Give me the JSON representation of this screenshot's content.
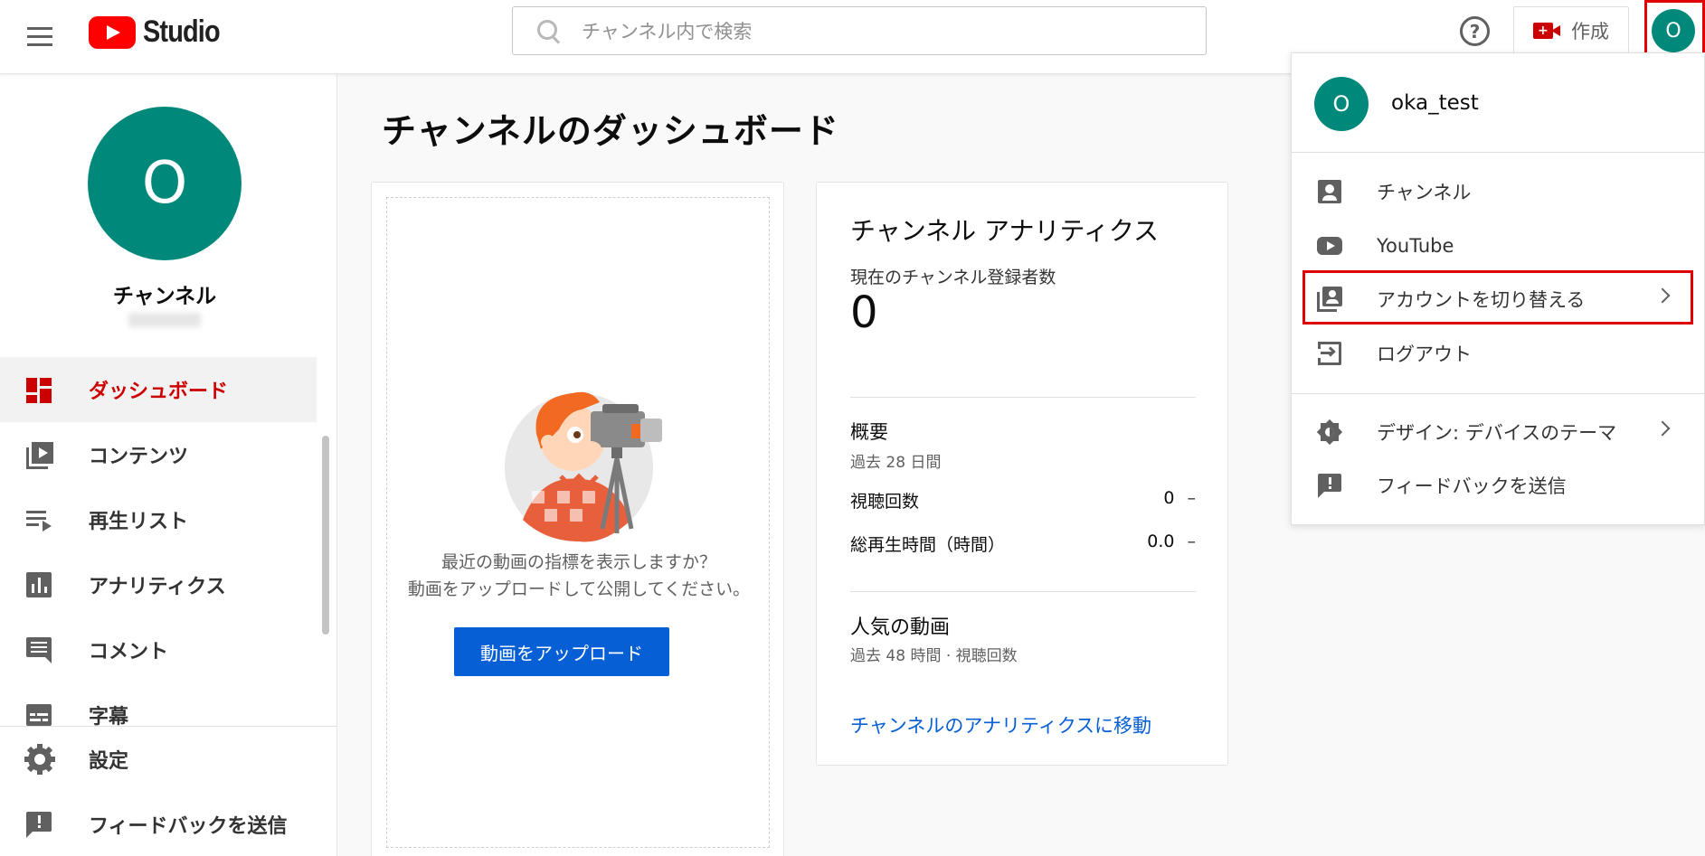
{
  "header": {
    "logo_text": "Studio",
    "search_placeholder": "チャンネル内で検索",
    "help_symbol": "?",
    "create_label": "作成",
    "avatar_letter": "O"
  },
  "sidebar": {
    "avatar_letter": "O",
    "channel_title": "チャンネル",
    "nav": [
      {
        "label": "ダッシュボード",
        "icon": "dashboard-icon",
        "active": true
      },
      {
        "label": "コンテンツ",
        "icon": "content-icon"
      },
      {
        "label": "再生リスト",
        "icon": "playlist-icon"
      },
      {
        "label": "アナリティクス",
        "icon": "analytics-icon"
      },
      {
        "label": "コメント",
        "icon": "comment-icon"
      },
      {
        "label": "字幕",
        "icon": "subtitles-icon"
      }
    ],
    "bottom": [
      {
        "label": "設定",
        "icon": "gear-icon"
      },
      {
        "label": "フィードバックを送信",
        "icon": "feedback-icon"
      }
    ]
  },
  "main": {
    "page_title": "チャンネルのダッシュボード",
    "upload_card": {
      "text_line1": "最近の動画の指標を表示しますか？",
      "text_line2": "動画をアップロードして公開してください。",
      "button_label": "動画をアップロード"
    },
    "analytics_card": {
      "title": "チャンネル アナリティクス",
      "subscribers_label": "現在のチャンネル登録者数",
      "subscribers_value": "0",
      "summary_title": "概要",
      "summary_period": "過去 28 日間",
      "rows": [
        {
          "label": "視聴回数",
          "value": "0",
          "change": "–"
        },
        {
          "label": "総再生時間（時間）",
          "value": "0.0",
          "change": "–"
        }
      ],
      "popular_title": "人気の動画",
      "popular_period": "過去 48 時間 · 視聴回数",
      "link_label": "チャンネルのアナリティクスに移動"
    }
  },
  "account_menu": {
    "avatar_letter": "O",
    "user_name": "oka_test",
    "items": [
      {
        "label": "チャンネル",
        "icon": "account-box-icon"
      },
      {
        "label": "YouTube",
        "icon": "youtube-icon"
      },
      {
        "label": "アカウントを切り替える",
        "icon": "switch-account-icon",
        "has_arrow": true,
        "highlighted": true
      },
      {
        "label": "ログアウト",
        "icon": "logout-icon"
      },
      {
        "label": "デザイン: デバイスのテーマ",
        "icon": "theme-icon",
        "has_arrow": true
      },
      {
        "label": "フィードバックを送信",
        "icon": "feedback-icon"
      }
    ]
  },
  "colors": {
    "accent_red": "#cc0000",
    "avatar_teal": "#00897b",
    "link_blue": "#065fd4",
    "highlight_box": "#e00000"
  }
}
